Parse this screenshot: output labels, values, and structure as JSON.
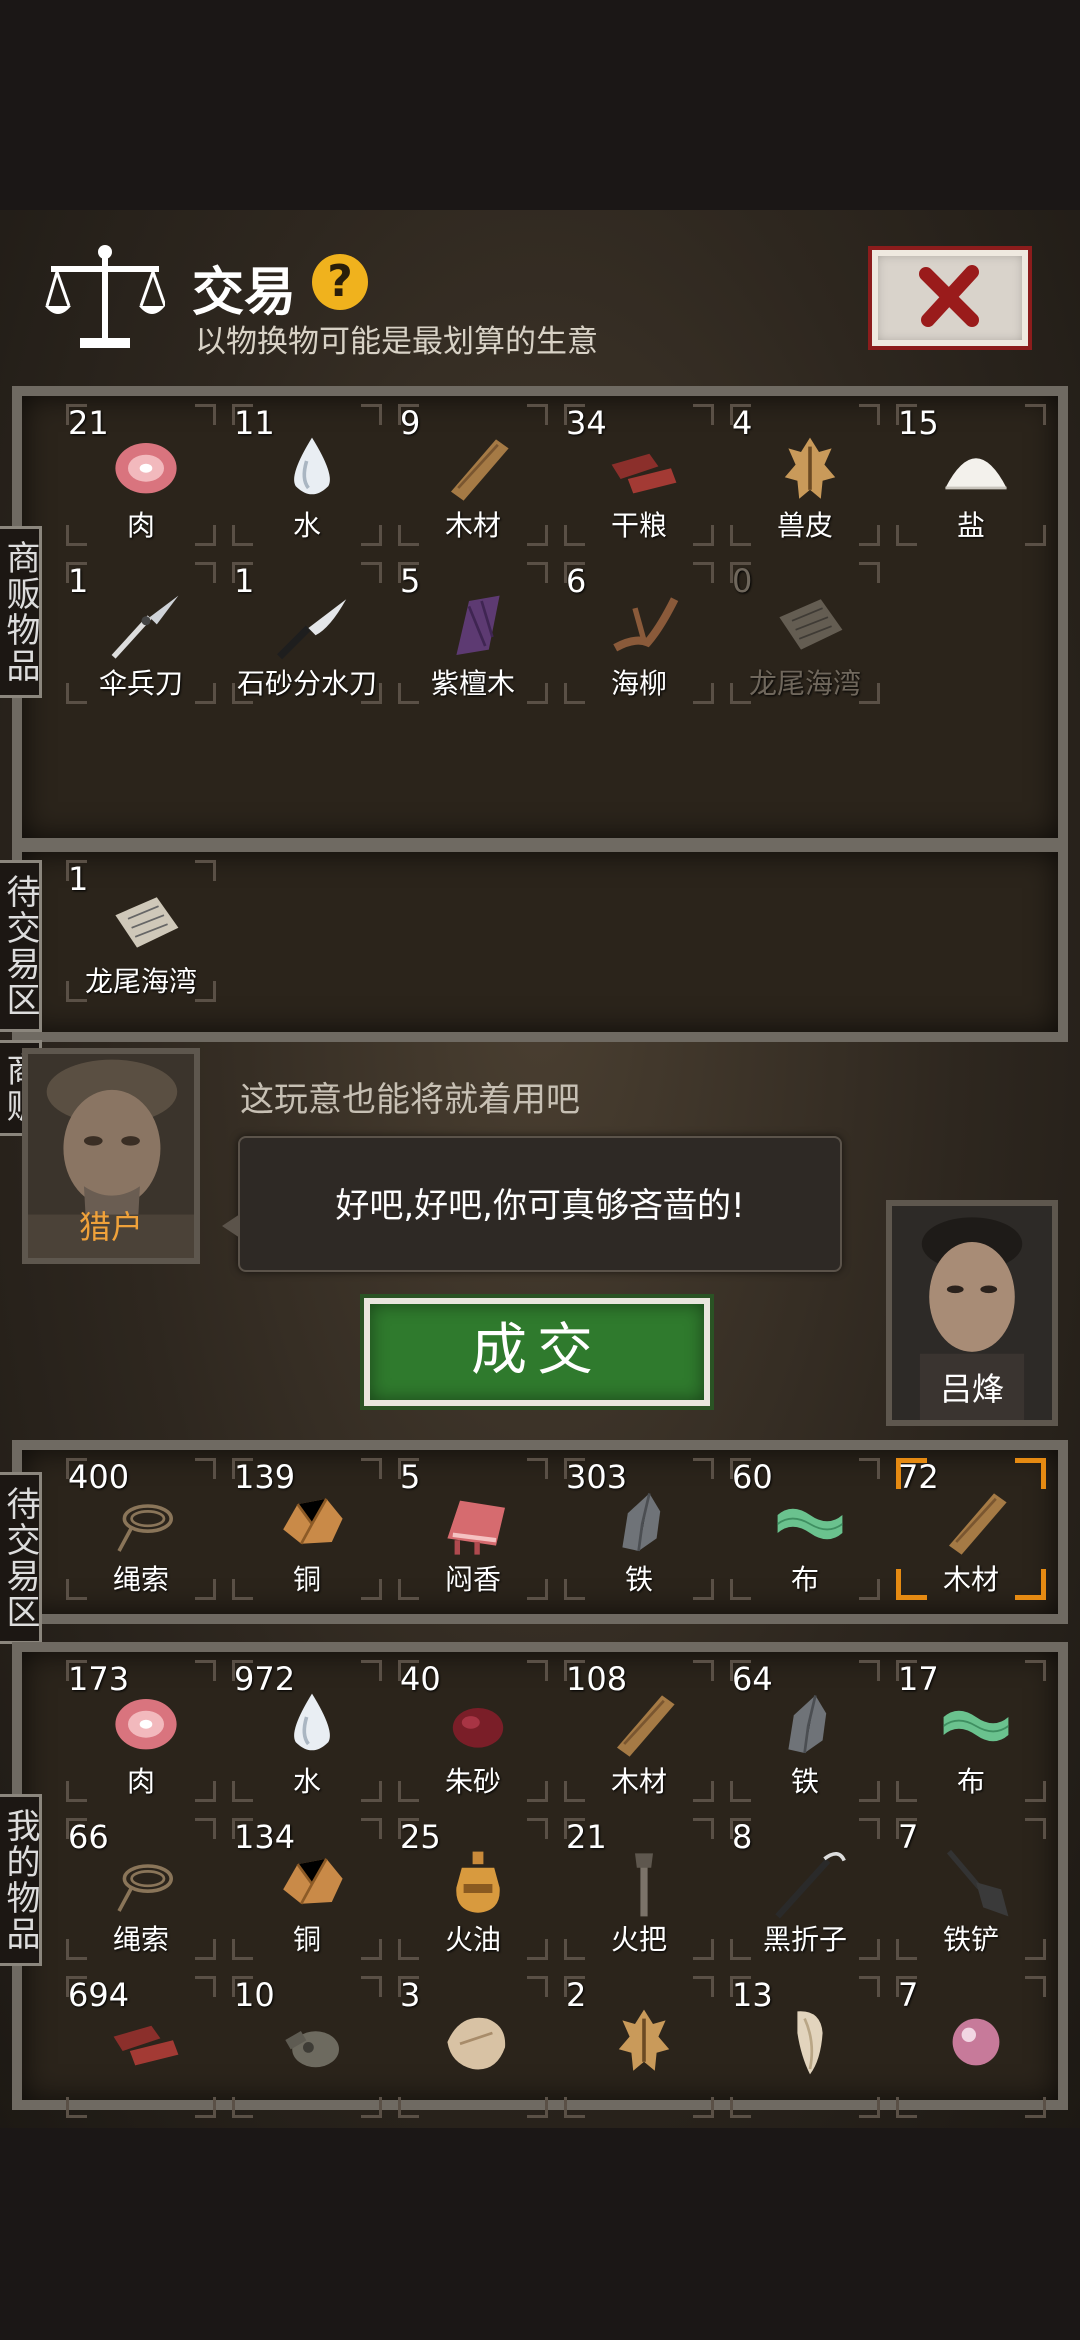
{
  "header": {
    "title": "交易",
    "subtitle": "以物换物可能是最划算的生意",
    "help_symbol": "?",
    "help_icon": "question-icon",
    "close_icon": "close-x-icon"
  },
  "labels": {
    "shop_items": "商贩物品",
    "pending_top": "待交易区",
    "merchant": "商贩",
    "pending_bottom": "待交易区",
    "my_items": "我的物品"
  },
  "shop_items": [
    {
      "qty": "21",
      "name": "肉",
      "icon": "meat-icon"
    },
    {
      "qty": "11",
      "name": "水",
      "icon": "water-icon"
    },
    {
      "qty": "9",
      "name": "木材",
      "icon": "wood-icon"
    },
    {
      "qty": "34",
      "name": "干粮",
      "icon": "jerky-icon"
    },
    {
      "qty": "4",
      "name": "兽皮",
      "icon": "hide-icon"
    },
    {
      "qty": "15",
      "name": "盐",
      "icon": "salt-icon"
    },
    {
      "qty": "1",
      "name": "伞兵刀",
      "icon": "paratrooper-knife-icon"
    },
    {
      "qty": "1",
      "name": "石砂分水刀",
      "icon": "knife-icon"
    },
    {
      "qty": "5",
      "name": "紫檀木",
      "icon": "rosewood-icon"
    },
    {
      "qty": "6",
      "name": "海柳",
      "icon": "sea-willow-icon"
    },
    {
      "qty": "0",
      "name": "龙尾海湾",
      "icon": "map-icon",
      "dim": true
    }
  ],
  "pending_top": [
    {
      "qty": "1",
      "name": "龙尾海湾",
      "icon": "map-icon"
    }
  ],
  "merchant": {
    "name": "猎户",
    "comment": "这玩意也能将就着用吧",
    "dialog": "好吧,好吧,你可真够吝啬的!"
  },
  "player": {
    "name": "吕烽",
    "stars": "★★"
  },
  "deal_button": "成交",
  "pending_bottom": [
    {
      "qty": "400",
      "name": "绳索",
      "icon": "rope-icon"
    },
    {
      "qty": "139",
      "name": "铜",
      "icon": "copper-icon"
    },
    {
      "qty": "5",
      "name": "闷香",
      "icon": "incense-icon"
    },
    {
      "qty": "303",
      "name": "铁",
      "icon": "iron-icon"
    },
    {
      "qty": "60",
      "name": "布",
      "icon": "cloth-icon"
    },
    {
      "qty": "72",
      "name": "木材",
      "icon": "wood-icon",
      "selected": true
    }
  ],
  "my_items": [
    {
      "qty": "173",
      "name": "肉",
      "icon": "meat-icon"
    },
    {
      "qty": "972",
      "name": "水",
      "icon": "water-icon"
    },
    {
      "qty": "40",
      "name": "朱砂",
      "icon": "cinnabar-icon"
    },
    {
      "qty": "108",
      "name": "木材",
      "icon": "wood-icon"
    },
    {
      "qty": "64",
      "name": "铁",
      "icon": "iron-icon"
    },
    {
      "qty": "17",
      "name": "布",
      "icon": "cloth-icon"
    },
    {
      "qty": "66",
      "name": "绳索",
      "icon": "rope-icon"
    },
    {
      "qty": "134",
      "name": "铜",
      "icon": "copper-icon"
    },
    {
      "qty": "25",
      "name": "火油",
      "icon": "oil-icon"
    },
    {
      "qty": "21",
      "name": "火把",
      "icon": "torch-icon"
    },
    {
      "qty": "8",
      "name": "黑折子",
      "icon": "black-fold-icon"
    },
    {
      "qty": "7",
      "name": "铁铲",
      "icon": "shovel-icon"
    },
    {
      "qty": "694",
      "name": "",
      "icon": "jerky-icon"
    },
    {
      "qty": "10",
      "name": "",
      "icon": "gourd-icon"
    },
    {
      "qty": "3",
      "name": "",
      "icon": "bone-icon"
    },
    {
      "qty": "2",
      "name": "",
      "icon": "hide-icon"
    },
    {
      "qty": "13",
      "name": "",
      "icon": "fang-icon"
    },
    {
      "qty": "7",
      "name": "",
      "icon": "pearl-icon"
    }
  ],
  "colors": {
    "accent_selected": "#e58a12",
    "deal_green": "#2f7a2d",
    "close_red": "#8c1c1c",
    "merchant_name": "#f0a23a"
  }
}
